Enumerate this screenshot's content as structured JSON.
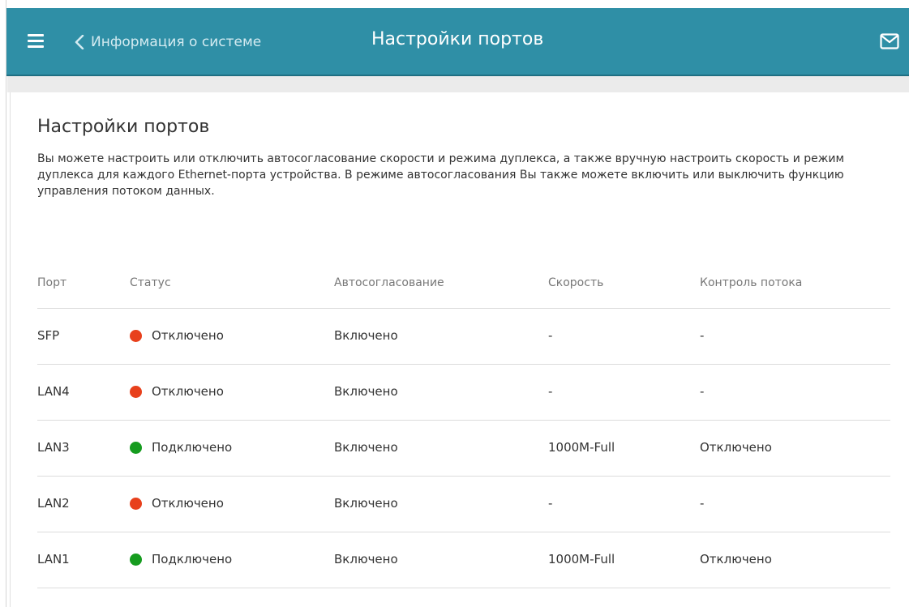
{
  "header": {
    "back_label": "Информация о системе",
    "title": "Настройки портов",
    "bg_color": "#2f8fa6"
  },
  "main": {
    "title": "Настройки портов",
    "description": "Вы можете настроить или отключить автосогласование скорости и режима дуплекса, а также вручную настроить скорость и режим дуплекса для каждого Ethernet-порта устройства. В режиме автосогласования Вы также можете включить или выключить функцию управления потоком данных."
  },
  "table": {
    "columns": [
      "Порт",
      "Статус",
      "Автосогласование",
      "Скорость",
      "Контроль потока"
    ],
    "rows": [
      {
        "port": "SFP",
        "status": "Отключено",
        "status_color": "#e8401c",
        "auto": "Включено",
        "speed": "-",
        "flow": "-"
      },
      {
        "port": "LAN4",
        "status": "Отключено",
        "status_color": "#e8401c",
        "auto": "Включено",
        "speed": "-",
        "flow": "-"
      },
      {
        "port": "LAN3",
        "status": "Подключено",
        "status_color": "#169c1f",
        "auto": "Включено",
        "speed": "1000M-Full",
        "flow": "Отключено"
      },
      {
        "port": "LAN2",
        "status": "Отключено",
        "status_color": "#e8401c",
        "auto": "Включено",
        "speed": "-",
        "flow": "-"
      },
      {
        "port": "LAN1",
        "status": "Подключено",
        "status_color": "#169c1f",
        "auto": "Включено",
        "speed": "1000M-Full",
        "flow": "Отключено"
      }
    ]
  },
  "icons": {
    "menu": "hamburger-menu-icon",
    "back": "chevron-left-icon",
    "mail": "mail-icon"
  }
}
